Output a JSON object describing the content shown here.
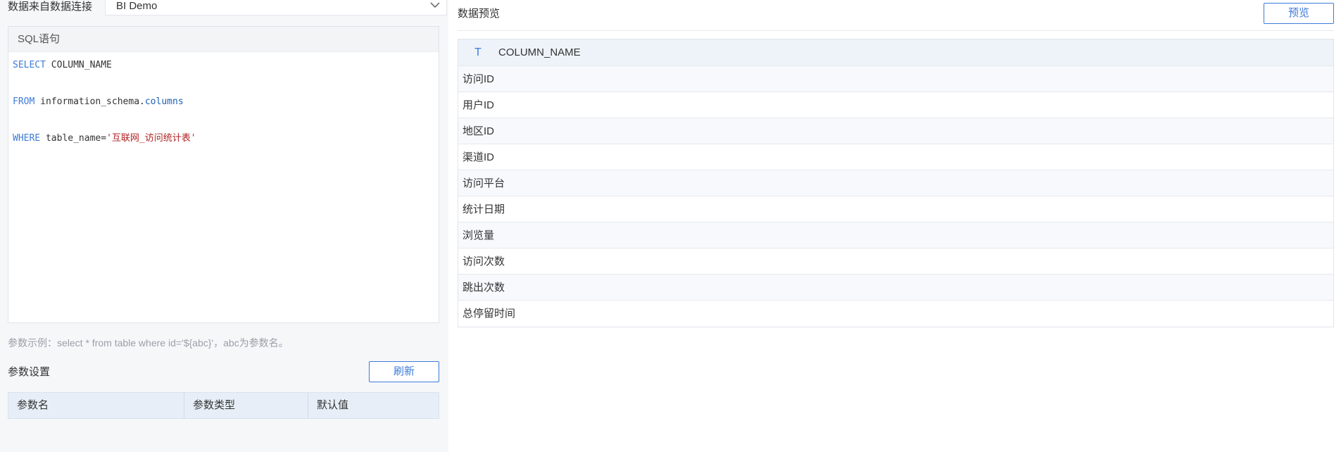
{
  "connection": {
    "label": "数据来自数据连接",
    "selected": "BI Demo"
  },
  "sql": {
    "header": "SQL语句",
    "lines": [
      {
        "kw": "SELECT",
        "rest": " COLUMN_NAME"
      },
      {
        "kw": "FROM",
        "rest": " information_schema.",
        "col": "columns"
      },
      {
        "kw": "WHERE",
        "rest": " table_name=",
        "str": "'互联网_访问统计表'"
      }
    ]
  },
  "hint": "参数示例：select * from table where id='${abc}'，abc为参数名。",
  "params": {
    "title": "参数设置",
    "refresh_label": "刷新",
    "columns": [
      "参数名",
      "参数类型",
      "默认值"
    ]
  },
  "preview": {
    "title": "数据预览",
    "button_label": "预览",
    "column_type_icon": "T",
    "column_header": "COLUMN_NAME",
    "rows": [
      "访问ID",
      "用户ID",
      "地区ID",
      "渠道ID",
      "访问平台",
      "统计日期",
      "浏览量",
      "访问次数",
      "跳出次数",
      "总停留时间"
    ]
  },
  "colors": {
    "accent": "#3d7bd9",
    "string_literal": "#b22222"
  }
}
